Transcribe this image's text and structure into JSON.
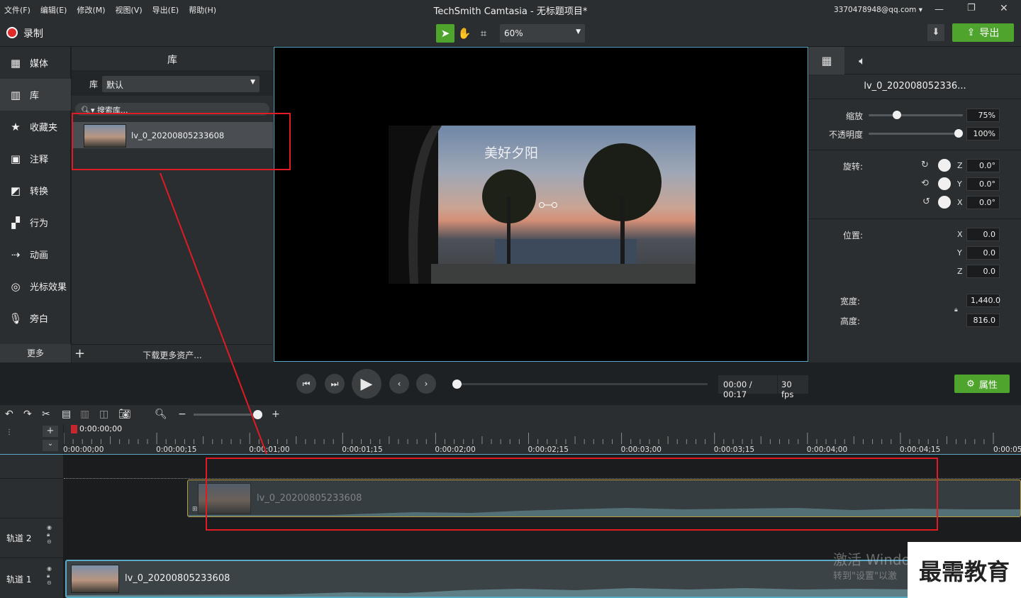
{
  "menu": [
    "文件(F)",
    "编辑(E)",
    "修改(M)",
    "视图(V)",
    "导出(E)",
    "帮助(H)"
  ],
  "window": {
    "title": "TechSmith Camtasia - 无标题项目*",
    "account": "3370478948@qq.com ▾"
  },
  "toolbar": {
    "record_label": "录制",
    "zoom": "60%",
    "export_label": "导出"
  },
  "sidebar": {
    "items": [
      {
        "label": "媒体",
        "icon": "film-icon"
      },
      {
        "label": "库",
        "icon": "library-icon"
      },
      {
        "label": "收藏夹",
        "icon": "star-icon"
      },
      {
        "label": "注释",
        "icon": "annotation-icon"
      },
      {
        "label": "转换",
        "icon": "transition-icon"
      },
      {
        "label": "行为",
        "icon": "behavior-icon"
      },
      {
        "label": "动画",
        "icon": "animation-icon"
      },
      {
        "label": "光标效果",
        "icon": "cursor-icon"
      },
      {
        "label": "旁白",
        "icon": "microphone-icon"
      }
    ],
    "more_label": "更多"
  },
  "library": {
    "title": "库",
    "library_label": "库",
    "library_selected": "默认",
    "search_placeholder": "搜索库...",
    "item_name": "lv_0_20200805233608",
    "download_more": "下载更多资产..."
  },
  "canvas": {
    "subtitle": "美好夕阳"
  },
  "properties": {
    "clip_name": "lv_0_202008052336...",
    "scale_label": "缩放",
    "scale_value": "75%",
    "scale_fraction": 0.28,
    "opacity_label": "不透明度",
    "opacity_value": "100%",
    "opacity_fraction": 1.0,
    "rotation_label": "旋转:",
    "rotation": [
      {
        "axis": "Z",
        "value": "0.0°"
      },
      {
        "axis": "Y",
        "value": "0.0°"
      },
      {
        "axis": "X",
        "value": "0.0°"
      }
    ],
    "position_label": "位置:",
    "position": [
      {
        "axis": "X",
        "value": "0.0"
      },
      {
        "axis": "Y",
        "value": "0.0"
      },
      {
        "axis": "Z",
        "value": "0.0"
      }
    ],
    "width_label": "宽度:",
    "width_value": "1,440.0",
    "height_label": "高度:",
    "height_value": "816.0",
    "button_label": "属性"
  },
  "playback": {
    "time": "00:00 / 00:17",
    "fps": "30 fps",
    "progress_fraction": 0.0
  },
  "timeline": {
    "playhead_time": "0:00:00;00",
    "ticks": [
      "0:00:00;00",
      "0:00:00;15",
      "0:00:01;00",
      "0:00:01;15",
      "0:00:02;00",
      "0:00:02;15",
      "0:00:03;00",
      "0:00:03;15",
      "0:00:04;00",
      "0:00:04;15",
      "0:00:05"
    ],
    "tracks": [
      {
        "name": "轨道 2"
      },
      {
        "name": "轨道 1"
      }
    ],
    "dragged_clip_name": "lv_0_20200805233608",
    "track1_clip_name": "lv_0_20200805233608"
  },
  "watermark": {
    "line1": "激活 Windo",
    "line2": "转到\"设置\"以激",
    "brand": "最需教育"
  },
  "colors": {
    "accent_green": "#4ea42d",
    "record_red": "#e02b2b",
    "annotation_red": "#e01b24",
    "selection_blue": "#5aa9c7",
    "clip_yellow": "#d6b44a"
  }
}
